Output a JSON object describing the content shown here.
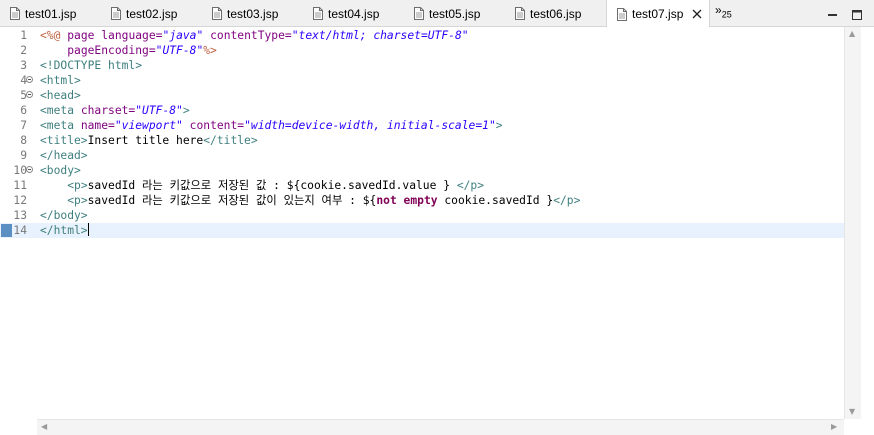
{
  "tabs": [
    {
      "label": "test01.jsp",
      "active": false
    },
    {
      "label": "test02.jsp",
      "active": false
    },
    {
      "label": "test03.jsp",
      "active": false
    },
    {
      "label": "test04.jsp",
      "active": false
    },
    {
      "label": "test05.jsp",
      "active": false
    },
    {
      "label": "test06.jsp",
      "active": false
    },
    {
      "label": "test07.jsp",
      "active": true
    }
  ],
  "overflow": {
    "chevron": "»",
    "count": "25"
  },
  "editor": {
    "current_line": 14,
    "lines": [
      {
        "n": "1",
        "fold": false,
        "tokens": [
          {
            "t": "jsp",
            "v": "<%@"
          },
          {
            "t": "txt",
            "v": " "
          },
          {
            "t": "attr",
            "v": "page"
          },
          {
            "t": "txt",
            "v": " "
          },
          {
            "t": "attr",
            "v": "language="
          },
          {
            "t": "str",
            "v": "\"java\""
          },
          {
            "t": "txt",
            "v": " "
          },
          {
            "t": "attr",
            "v": "contentType="
          },
          {
            "t": "str",
            "v": "\"text/html; charset=UTF-8\""
          }
        ]
      },
      {
        "n": "2",
        "fold": false,
        "tokens": [
          {
            "t": "txt",
            "v": "    "
          },
          {
            "t": "attr",
            "v": "pageEncoding="
          },
          {
            "t": "str",
            "v": "\"UTF-8\""
          },
          {
            "t": "jsp",
            "v": "%>"
          }
        ]
      },
      {
        "n": "3",
        "fold": false,
        "tokens": [
          {
            "t": "tag",
            "v": "<!DOCTYPE html>"
          }
        ]
      },
      {
        "n": "4",
        "fold": true,
        "tokens": [
          {
            "t": "tag",
            "v": "<html>"
          }
        ]
      },
      {
        "n": "5",
        "fold": true,
        "tokens": [
          {
            "t": "tag",
            "v": "<head>"
          }
        ]
      },
      {
        "n": "6",
        "fold": false,
        "tokens": [
          {
            "t": "tag",
            "v": "<meta"
          },
          {
            "t": "txt",
            "v": " "
          },
          {
            "t": "attr",
            "v": "charset="
          },
          {
            "t": "str",
            "v": "\"UTF-8\""
          },
          {
            "t": "tag",
            "v": ">"
          }
        ]
      },
      {
        "n": "7",
        "fold": false,
        "tokens": [
          {
            "t": "tag",
            "v": "<meta"
          },
          {
            "t": "txt",
            "v": " "
          },
          {
            "t": "attr",
            "v": "name="
          },
          {
            "t": "str",
            "v": "\"viewport\""
          },
          {
            "t": "txt",
            "v": " "
          },
          {
            "t": "attr",
            "v": "content="
          },
          {
            "t": "str",
            "v": "\"width=device-width, initial-scale=1\""
          },
          {
            "t": "tag",
            "v": ">"
          }
        ]
      },
      {
        "n": "8",
        "fold": false,
        "tokens": [
          {
            "t": "tag",
            "v": "<title>"
          },
          {
            "t": "txt",
            "v": "Insert title here"
          },
          {
            "t": "tag",
            "v": "</title>"
          }
        ]
      },
      {
        "n": "9",
        "fold": false,
        "tokens": [
          {
            "t": "tag",
            "v": "</head>"
          }
        ]
      },
      {
        "n": "10",
        "fold": true,
        "tokens": [
          {
            "t": "tag",
            "v": "<body>"
          }
        ]
      },
      {
        "n": "11",
        "fold": false,
        "tokens": [
          {
            "t": "txt",
            "v": "    "
          },
          {
            "t": "tag",
            "v": "<p>"
          },
          {
            "t": "txt",
            "v": "savedId 라는 키값으로 저장된 값 : ${cookie.savedId.value } "
          },
          {
            "t": "tag",
            "v": "</p>"
          }
        ]
      },
      {
        "n": "12",
        "fold": false,
        "tokens": [
          {
            "t": "txt",
            "v": "    "
          },
          {
            "t": "tag",
            "v": "<p>"
          },
          {
            "t": "txt",
            "v": "savedId 라는 키값으로 저장된 값이 있는지 여부 : ${"
          },
          {
            "t": "kw",
            "v": "not empty"
          },
          {
            "t": "txt",
            "v": " cookie.savedId }"
          },
          {
            "t": "tag",
            "v": "</p>"
          }
        ]
      },
      {
        "n": "13",
        "fold": false,
        "tokens": [
          {
            "t": "tag",
            "v": "</body>"
          }
        ]
      },
      {
        "n": "14",
        "fold": false,
        "tokens": [
          {
            "t": "tag",
            "v": "</html>"
          }
        ]
      }
    ]
  },
  "colors": {
    "jsp_delimiter": "#bf5f3f",
    "tag": "#3f7f7f",
    "attribute": "#7f007f",
    "string": "#2a00ff",
    "keyword": "#7f0055",
    "current_line": "#e8f2fe"
  },
  "icons": {
    "tab_file": "jsp-file-icon",
    "close": "close-icon",
    "minimize": "minimize-icon",
    "maximize": "maximize-icon"
  }
}
